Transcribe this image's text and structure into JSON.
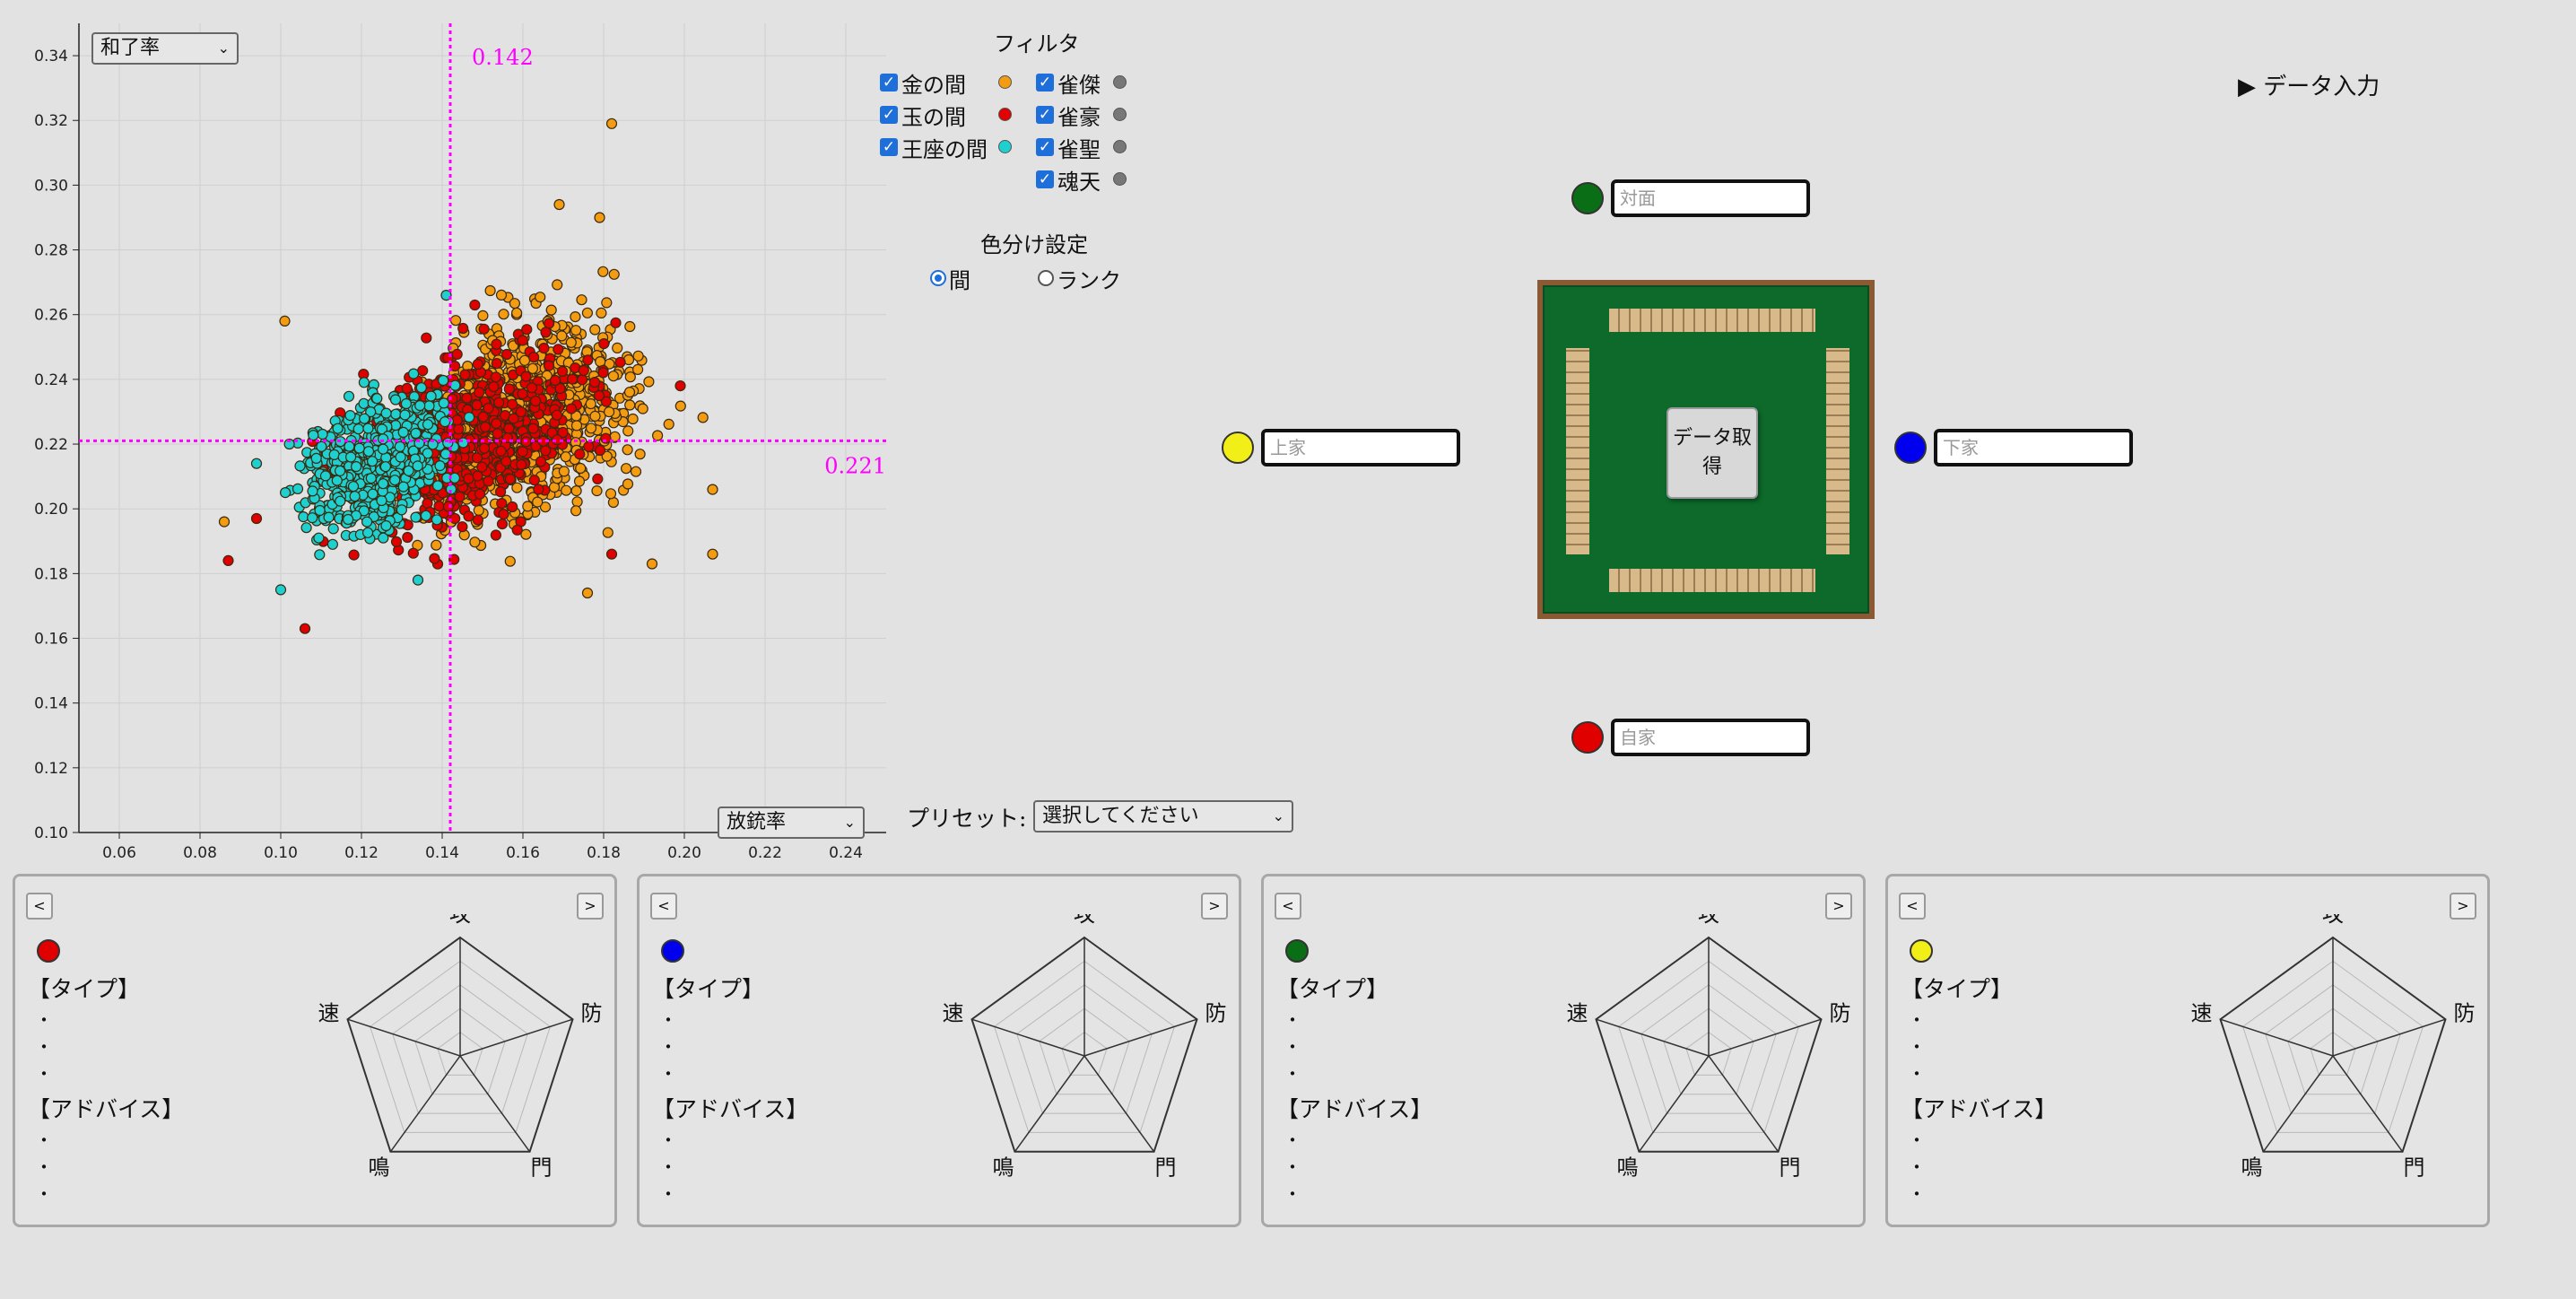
{
  "scatter": {
    "y_axis_select": "和了率",
    "x_axis_select": "放銃率",
    "x_line_label": "0.142",
    "y_line_label": "0.221",
    "line_color": "#ff00ff"
  },
  "filter": {
    "title": "フィルタ",
    "rooms": [
      {
        "label": "金の間",
        "color": "#f39c12"
      },
      {
        "label": "玉の間",
        "color": "#e10000"
      },
      {
        "label": "王座の間",
        "color": "#1fd0d0"
      }
    ],
    "ranks": [
      {
        "label": "雀傑",
        "color": "#777777"
      },
      {
        "label": "雀豪",
        "color": "#777777"
      },
      {
        "label": "雀聖",
        "color": "#777777"
      },
      {
        "label": "魂天",
        "color": "#777777"
      }
    ],
    "color_setting_title": "色分け設定",
    "color_options": [
      {
        "label": "間",
        "selected": true
      },
      {
        "label": "ランク",
        "selected": false
      }
    ]
  },
  "data_input_toggle": "▶ データ入力",
  "table": {
    "fetch_button": "データ取得",
    "seats": {
      "toimen": {
        "placeholder": "対面",
        "color": "#0a6e16"
      },
      "kamicha": {
        "placeholder": "上家",
        "color": "#f2ee18"
      },
      "shimocha": {
        "placeholder": "下家",
        "color": "#0000ee"
      },
      "jicha": {
        "placeholder": "自家",
        "color": "#e00000"
      }
    }
  },
  "preset": {
    "label": "プリセット:",
    "value": "選択してください"
  },
  "cards": [
    {
      "color": "#e00000",
      "type_heading": "【タイプ】",
      "advice_heading": "【アドバイス】",
      "bullets": "・",
      "prev": "<",
      "next": ">"
    },
    {
      "color": "#0000ee",
      "type_heading": "【タイプ】",
      "advice_heading": "【アドバイス】",
      "bullets": "・",
      "prev": "<",
      "next": ">"
    },
    {
      "color": "#0a6e16",
      "type_heading": "【タイプ】",
      "advice_heading": "【アドバイス】",
      "bullets": "・",
      "prev": "<",
      "next": ">"
    },
    {
      "color": "#f2ee18",
      "type_heading": "【タイプ】",
      "advice_heading": "【アドバイス】",
      "bullets": "・",
      "prev": "<",
      "next": ">"
    }
  ],
  "radar_labels": [
    "攻",
    "防",
    "門",
    "鳴",
    "速"
  ],
  "chart_data": {
    "type": "scatter",
    "xlabel": "放銃率",
    "ylabel": "和了率",
    "xlim": [
      0.05,
      0.25
    ],
    "ylim": [
      0.1,
      0.35
    ],
    "x_ticks": [
      "0.06",
      "0.08",
      "0.10",
      "0.12",
      "0.14",
      "0.16",
      "0.18",
      "0.20",
      "0.22",
      "0.24"
    ],
    "y_ticks": [
      "0.10",
      "0.12",
      "0.14",
      "0.16",
      "0.18",
      "0.20",
      "0.22",
      "0.24",
      "0.26",
      "0.28",
      "0.30",
      "0.32",
      "0.34"
    ],
    "grid": true,
    "reference_lines": {
      "x": 0.142,
      "y": 0.221
    },
    "series": [
      {
        "name": "金の間",
        "color": "#f39c12",
        "center": [
          0.16,
          0.228
        ],
        "spread": [
          0.02,
          0.02
        ],
        "count": 950,
        "extra_points": [
          [
            0.182,
            0.319
          ],
          [
            0.169,
            0.294
          ],
          [
            0.179,
            0.29
          ],
          [
            0.101,
            0.258
          ],
          [
            0.207,
            0.186
          ],
          [
            0.207,
            0.206
          ],
          [
            0.176,
            0.174
          ],
          [
            0.086,
            0.196
          ],
          [
            0.192,
            0.183
          ]
        ]
      },
      {
        "name": "玉の間",
        "color": "#e10000",
        "center": [
          0.148,
          0.222
        ],
        "spread": [
          0.02,
          0.018
        ],
        "count": 650,
        "extra_points": [
          [
            0.106,
            0.163
          ],
          [
            0.087,
            0.184
          ],
          [
            0.094,
            0.197
          ],
          [
            0.199,
            0.238
          ],
          [
            0.182,
            0.186
          ]
        ]
      },
      {
        "name": "王座の間",
        "color": "#1fd0d0",
        "center": [
          0.124,
          0.214
        ],
        "spread": [
          0.012,
          0.014
        ],
        "count": 650,
        "extra_points": [
          [
            0.094,
            0.214
          ],
          [
            0.1,
            0.175
          ],
          [
            0.141,
            0.266
          ],
          [
            0.134,
            0.178
          ]
        ]
      }
    ]
  }
}
